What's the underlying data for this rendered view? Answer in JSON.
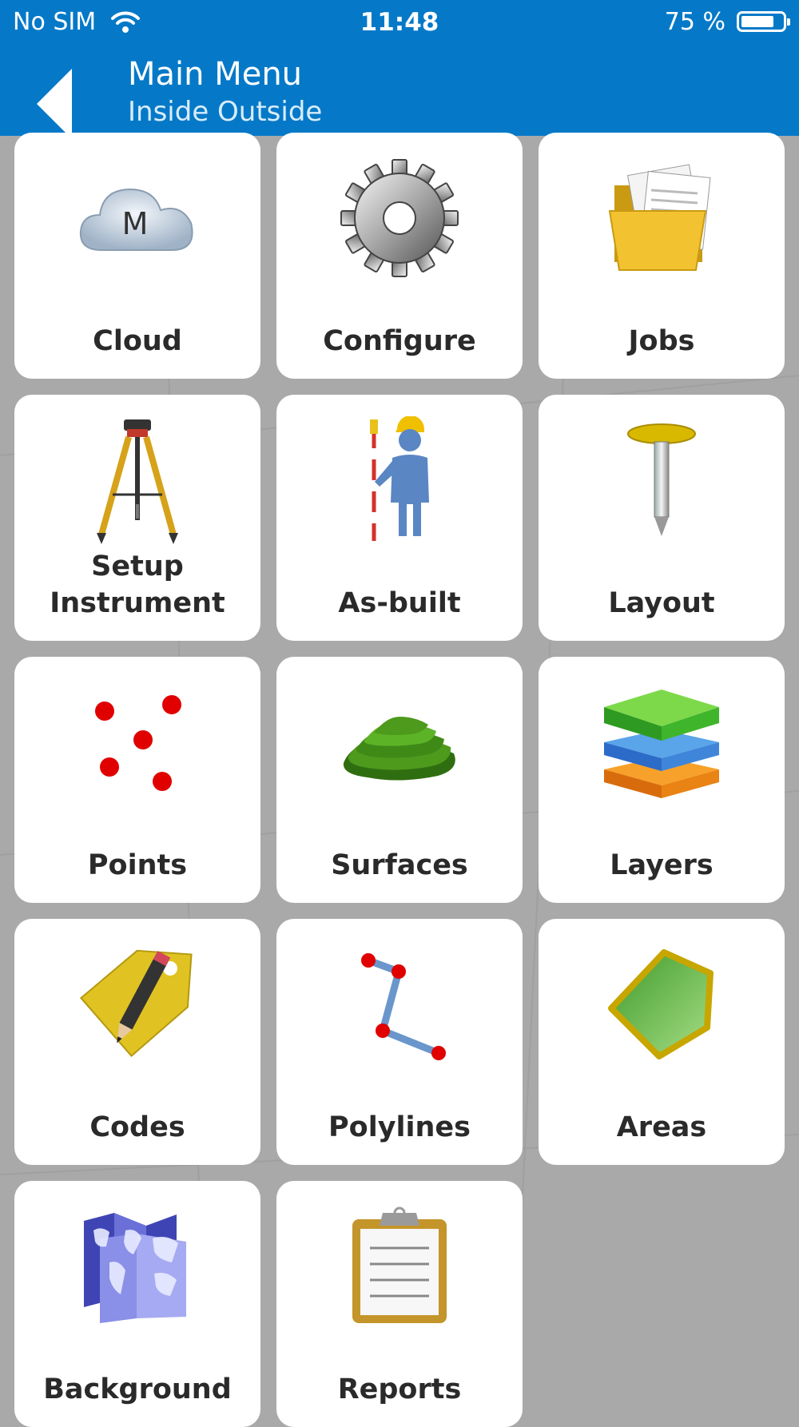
{
  "status_bar": {
    "carrier": "No SIM",
    "time": "11:48",
    "battery": "75 %",
    "battery_level": 0.75
  },
  "nav": {
    "title": "Main Menu",
    "subtitle": "Inside Outside"
  },
  "menu": [
    {
      "label": "Cloud",
      "icon": "cloud-icon"
    },
    {
      "label": "Configure",
      "icon": "gear-icon"
    },
    {
      "label": "Jobs",
      "icon": "folder-icon"
    },
    {
      "label": "Setup\nInstrument",
      "icon": "tripod-icon"
    },
    {
      "label": "As-built",
      "icon": "surveyor-icon"
    },
    {
      "label": "Layout",
      "icon": "pin-icon"
    },
    {
      "label": "Points",
      "icon": "points-icon"
    },
    {
      "label": "Surfaces",
      "icon": "surface-icon"
    },
    {
      "label": "Layers",
      "icon": "layers-icon"
    },
    {
      "label": "Codes",
      "icon": "tag-pencil-icon"
    },
    {
      "label": "Polylines",
      "icon": "polyline-icon"
    },
    {
      "label": "Areas",
      "icon": "pentagon-icon"
    },
    {
      "label": "Background",
      "icon": "map-icon"
    },
    {
      "label": "Reports",
      "icon": "clipboard-icon"
    }
  ],
  "cloud_letter": "M",
  "colors": {
    "accent": "#0579c8",
    "backdrop": "#a9a9a9"
  }
}
